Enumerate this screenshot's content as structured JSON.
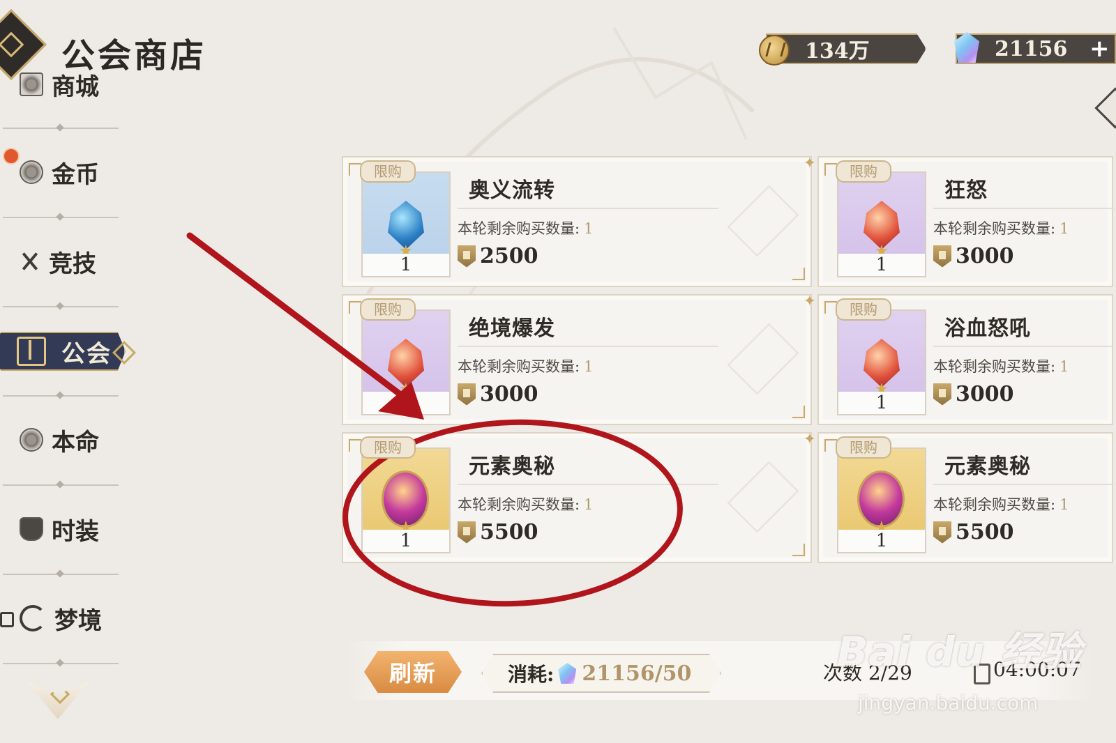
{
  "header": {
    "title": "公会商店",
    "gold_amount": "134万",
    "gem_amount": "21156",
    "plus_label": "+"
  },
  "sidebar": {
    "items": [
      {
        "label": "商城",
        "icon": "gift-icon"
      },
      {
        "label": "金币",
        "icon": "coin-icon"
      },
      {
        "label": "竞技",
        "icon": "crossed-swords-icon"
      },
      {
        "label": "公会",
        "icon": "guild-banner-icon",
        "active": true
      },
      {
        "label": "本命",
        "icon": "emblem-icon"
      },
      {
        "label": "时装",
        "icon": "hat-icon"
      },
      {
        "label": "梦境",
        "icon": "moon-icon",
        "locked": true
      }
    ]
  },
  "shop": {
    "items": [
      {
        "name": "奥义流转",
        "tag": "限购",
        "remain_label": "本轮剩余购买数量:",
        "remain": "1",
        "qty": "1",
        "price": "2500",
        "color": "blue"
      },
      {
        "name": "狂怒",
        "tag": "限购",
        "remain_label": "本轮剩余购买数量:",
        "remain": "1",
        "qty": "1",
        "price": "3000",
        "color": "purple"
      },
      {
        "name": "绝境爆发",
        "tag": "限购",
        "remain_label": "本轮剩余购买数量:",
        "remain": "1",
        "qty": "1",
        "price": "3000",
        "color": "purple"
      },
      {
        "name": "浴血怒吼",
        "tag": "限购",
        "remain_label": "本轮剩余购买数量:",
        "remain": "1",
        "qty": "1",
        "price": "3000",
        "color": "purple"
      },
      {
        "name": "元素奥秘",
        "tag": "限购",
        "remain_label": "本轮剩余购买数量:",
        "remain": "1",
        "qty": "1",
        "price": "5500",
        "color": "gold"
      },
      {
        "name": "元素奥秘",
        "tag": "限购",
        "remain_label": "本轮剩余购买数量:",
        "remain": "1",
        "qty": "1",
        "price": "5500",
        "color": "gold"
      }
    ]
  },
  "footer": {
    "refresh_label": "刷新",
    "cost_label": "消耗:",
    "cost_value": "21156/50",
    "count_label": "次数 2/29",
    "timer": "04:00:07"
  },
  "watermark": {
    "main": "Bai du 经验",
    "sub": "jingyan.baidu.com"
  },
  "colors": {
    "annotation": "#b0151c",
    "accent_gold": "#c9a96a",
    "active_nav": "#323a56",
    "refresh": "#e09a50"
  }
}
